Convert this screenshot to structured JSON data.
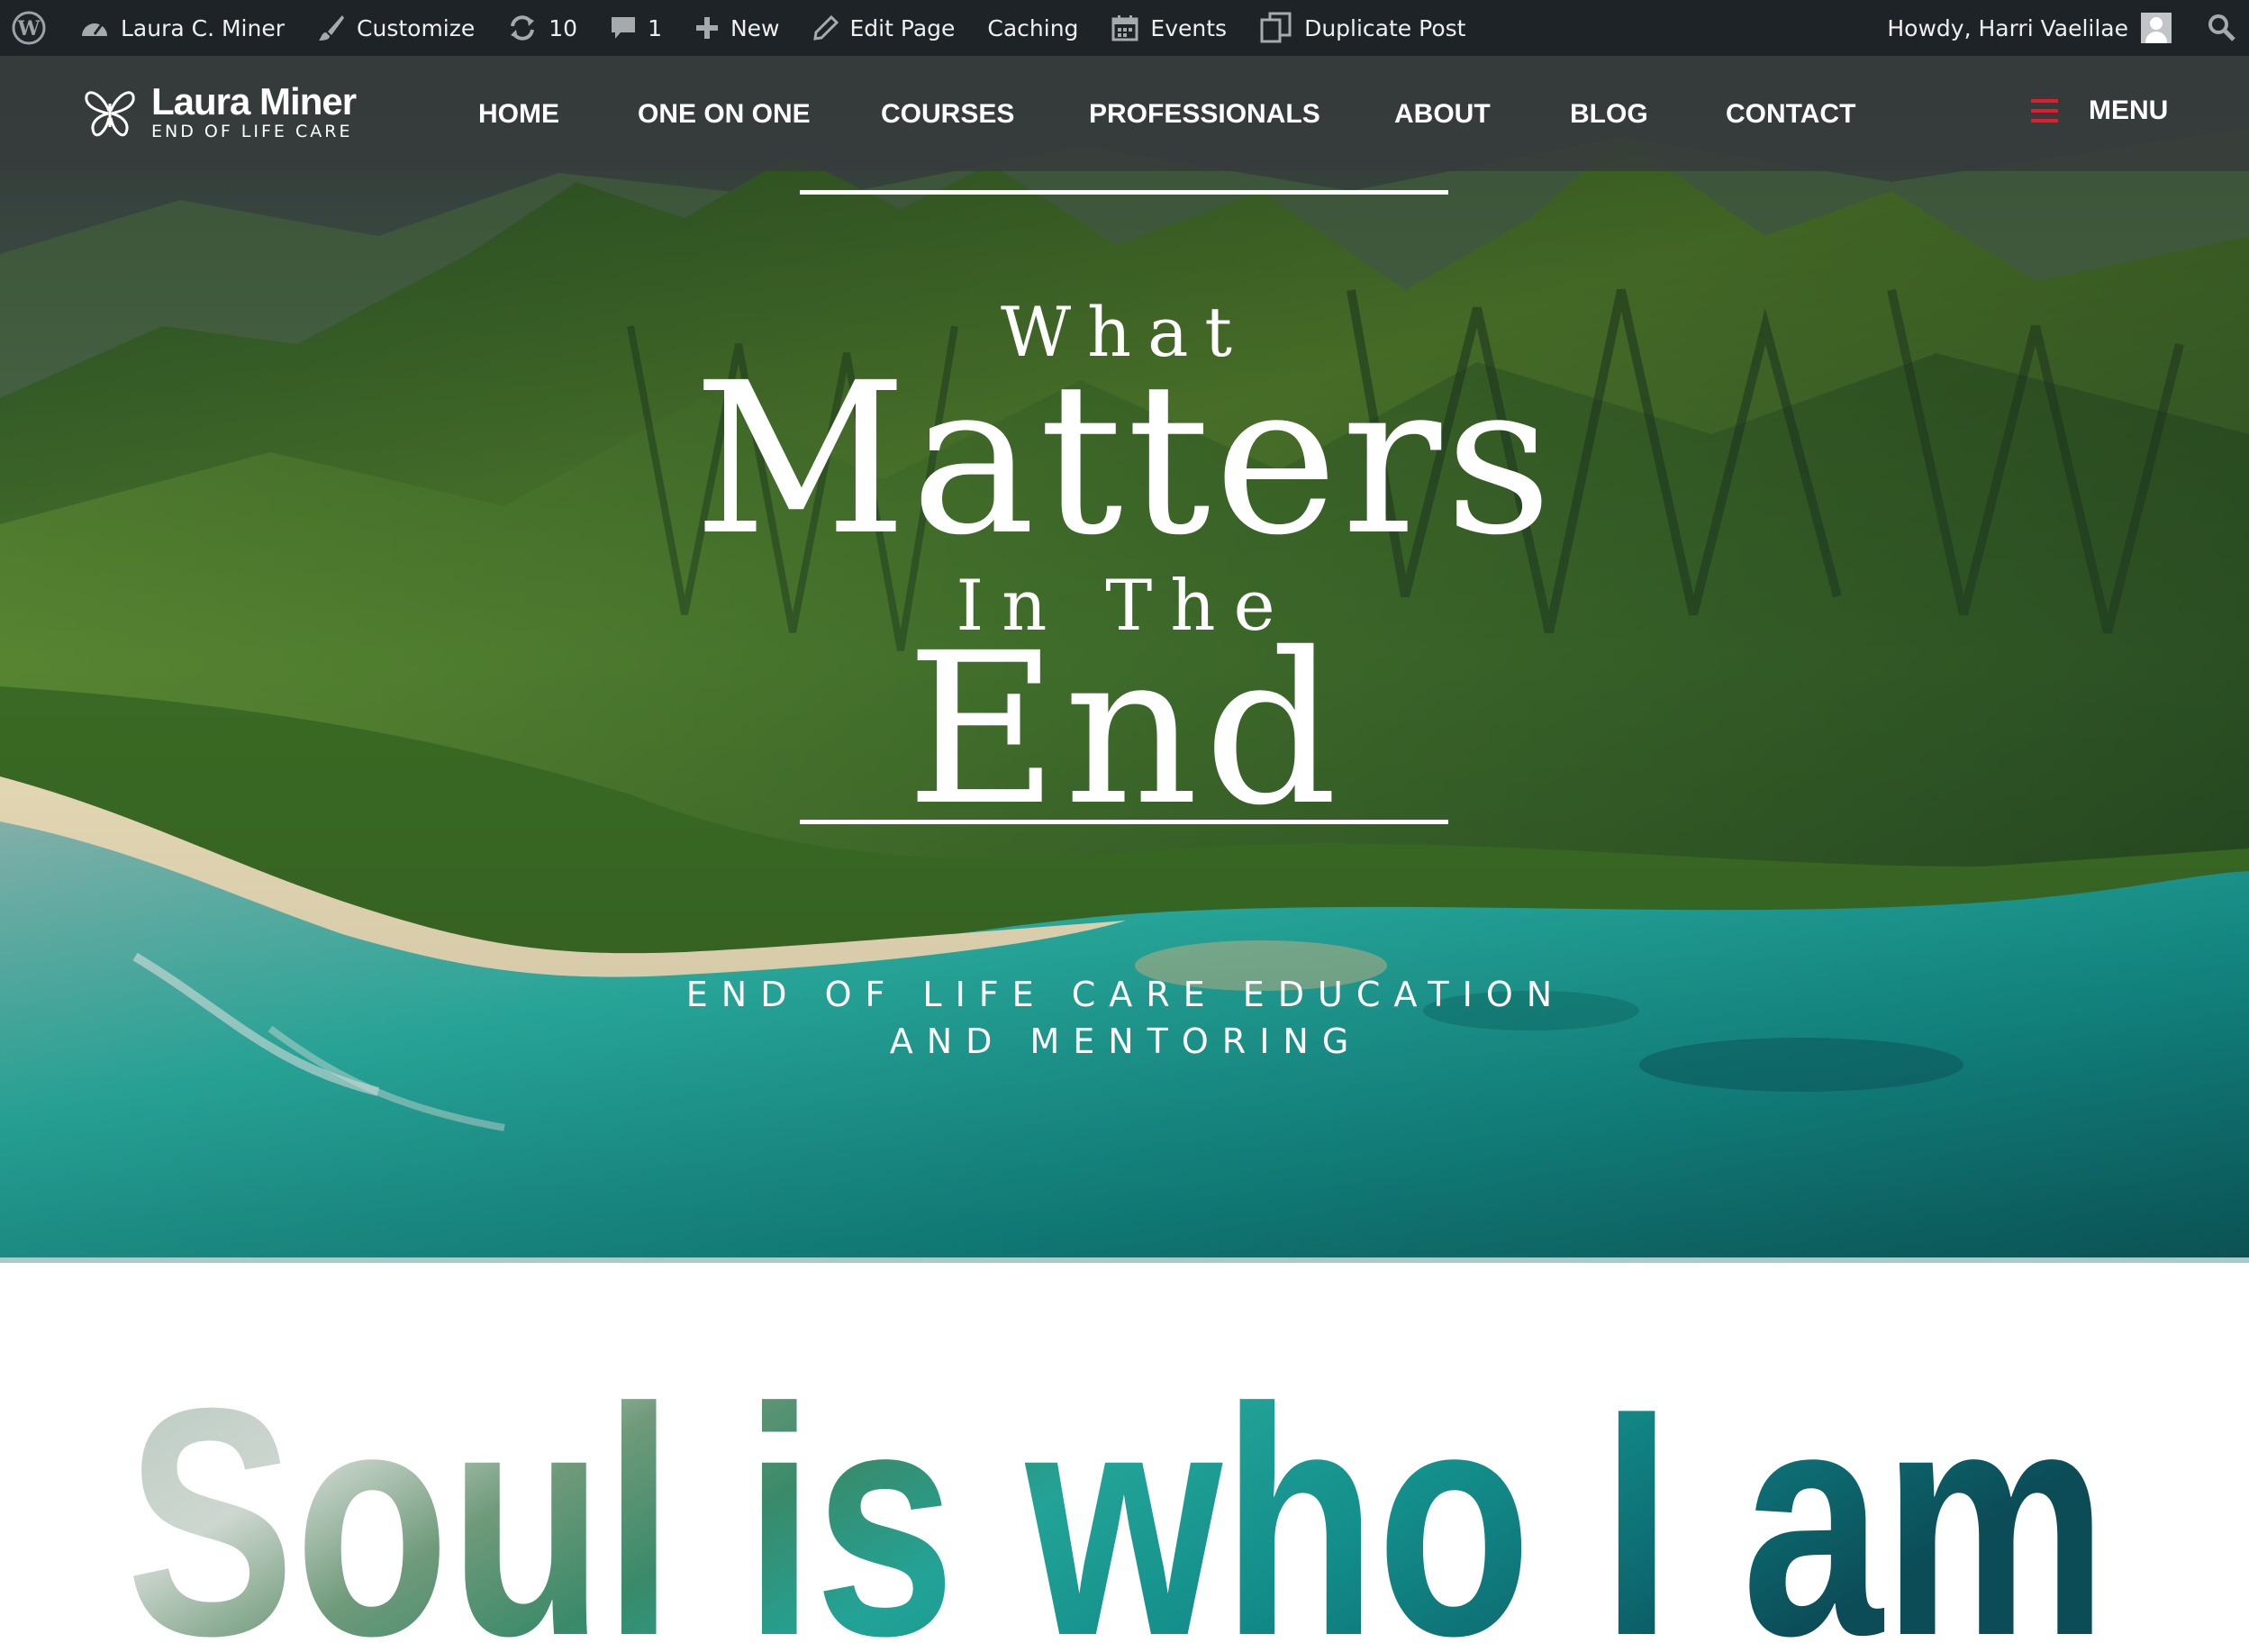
{
  "admin_bar": {
    "site_name": "Laura C. Miner",
    "customize": "Customize",
    "updates_count": "10",
    "comments_count": "1",
    "new": "New",
    "edit_page": "Edit Page",
    "caching": "Caching",
    "events": "Events",
    "duplicate_post": "Duplicate Post",
    "howdy": "Howdy, Harri Vaelilae"
  },
  "header": {
    "logo_name": "Laura Miner",
    "logo_tagline": "END OF LIFE CARE",
    "nav": [
      "HOME",
      "ONE ON ONE",
      "COURSES",
      "PROFESSIONALS",
      "ABOUT",
      "BLOG",
      "CONTACT"
    ],
    "menu_label": "MENU",
    "menu_icon_color": "#e21b2d"
  },
  "hero": {
    "line1": "What",
    "line2": "Matters",
    "line3": "In The",
    "line4": "End",
    "subtitle": "END OF LIFE CARE EDUCATION AND MENTORING"
  },
  "section": {
    "heading": "Soul is who I am"
  },
  "colors": {
    "admin_bar_bg": "#1d2327",
    "header_overlay": "#373a3c",
    "ocean": "#1aa39a"
  },
  "icons": [
    "wordpress-icon",
    "dashboard-icon",
    "brush-icon",
    "refresh-icon",
    "comment-icon",
    "plus-icon",
    "pencil-icon",
    "calendar-icon",
    "duplicate-icon",
    "search-icon",
    "butterfly-logo-icon",
    "hamburger-icon"
  ]
}
